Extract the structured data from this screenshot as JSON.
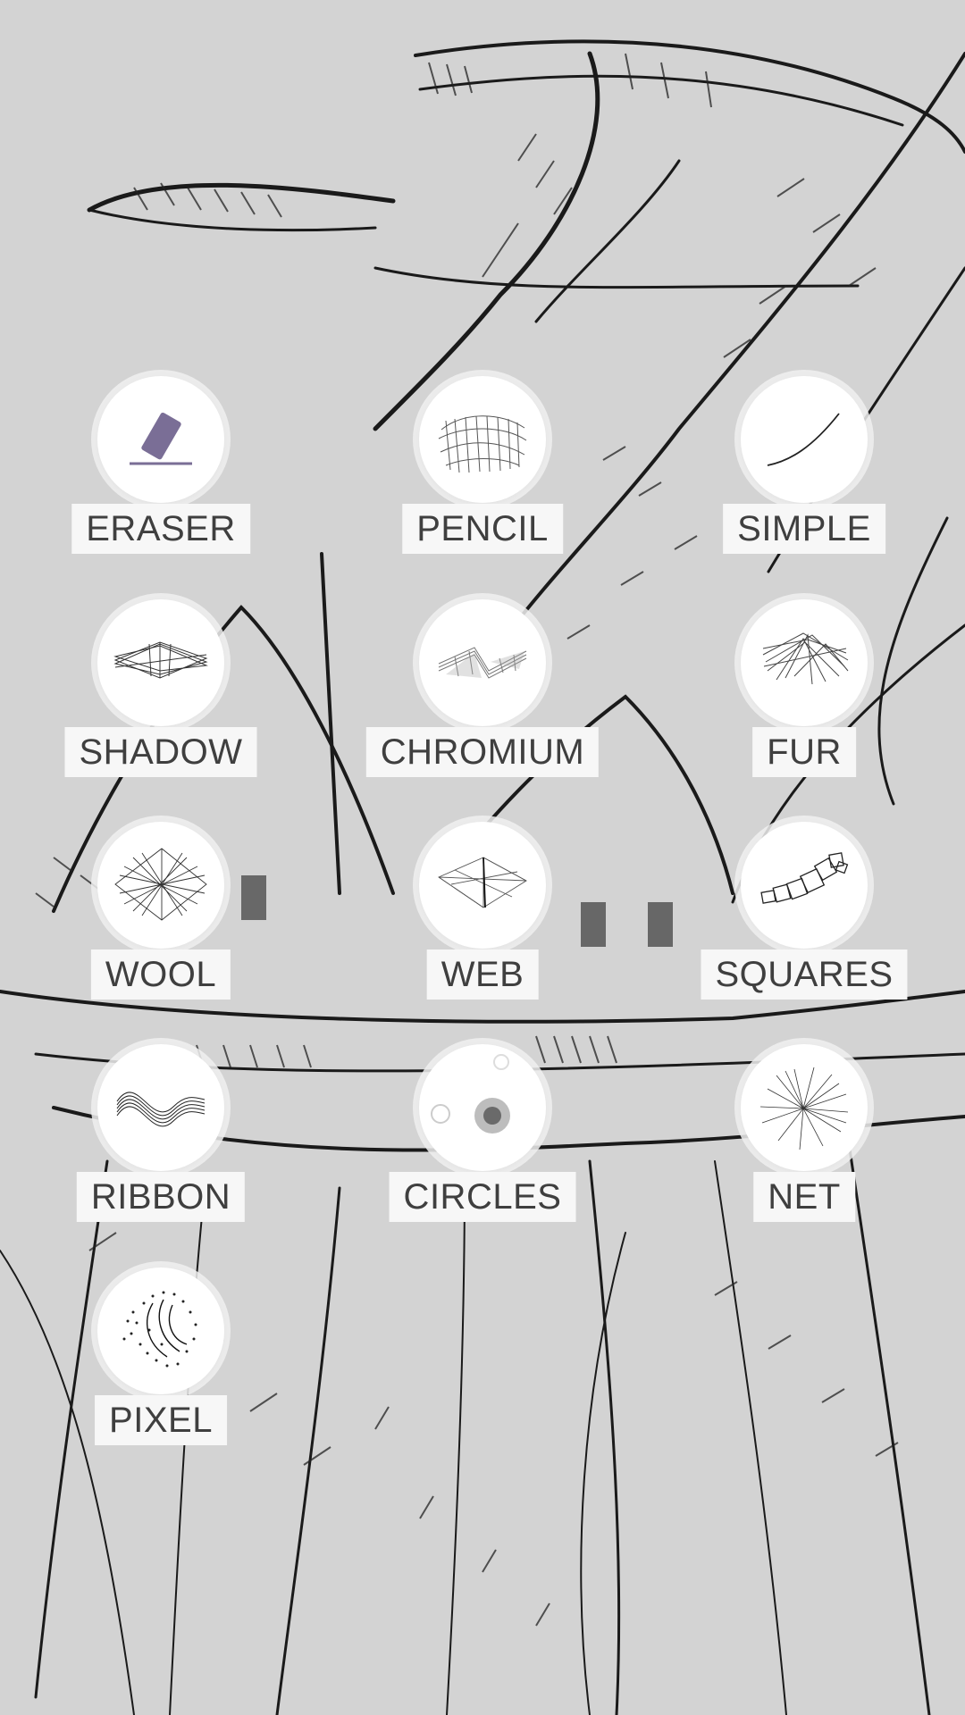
{
  "canvas": {
    "background": "#d3d3d3",
    "stroke_color": "#111111"
  },
  "brushes": [
    {
      "label": "ERASER",
      "icon": "eraser-icon",
      "accent": "#7a6e96"
    },
    {
      "label": "PENCIL",
      "icon": "pencil-brush-icon"
    },
    {
      "label": "SIMPLE",
      "icon": "simple-brush-icon"
    },
    {
      "label": "SHADOW",
      "icon": "shadow-brush-icon"
    },
    {
      "label": "CHROMIUM",
      "icon": "chromium-brush-icon"
    },
    {
      "label": "FUR",
      "icon": "fur-brush-icon"
    },
    {
      "label": "WOOL",
      "icon": "wool-brush-icon"
    },
    {
      "label": "WEB",
      "icon": "web-brush-icon"
    },
    {
      "label": "SQUARES",
      "icon": "squares-brush-icon"
    },
    {
      "label": "RIBBON",
      "icon": "ribbon-brush-icon"
    },
    {
      "label": "CIRCLES",
      "icon": "circles-brush-icon"
    },
    {
      "label": "NET",
      "icon": "net-brush-icon"
    },
    {
      "label": "PIXEL",
      "icon": "pixel-brush-icon"
    }
  ]
}
